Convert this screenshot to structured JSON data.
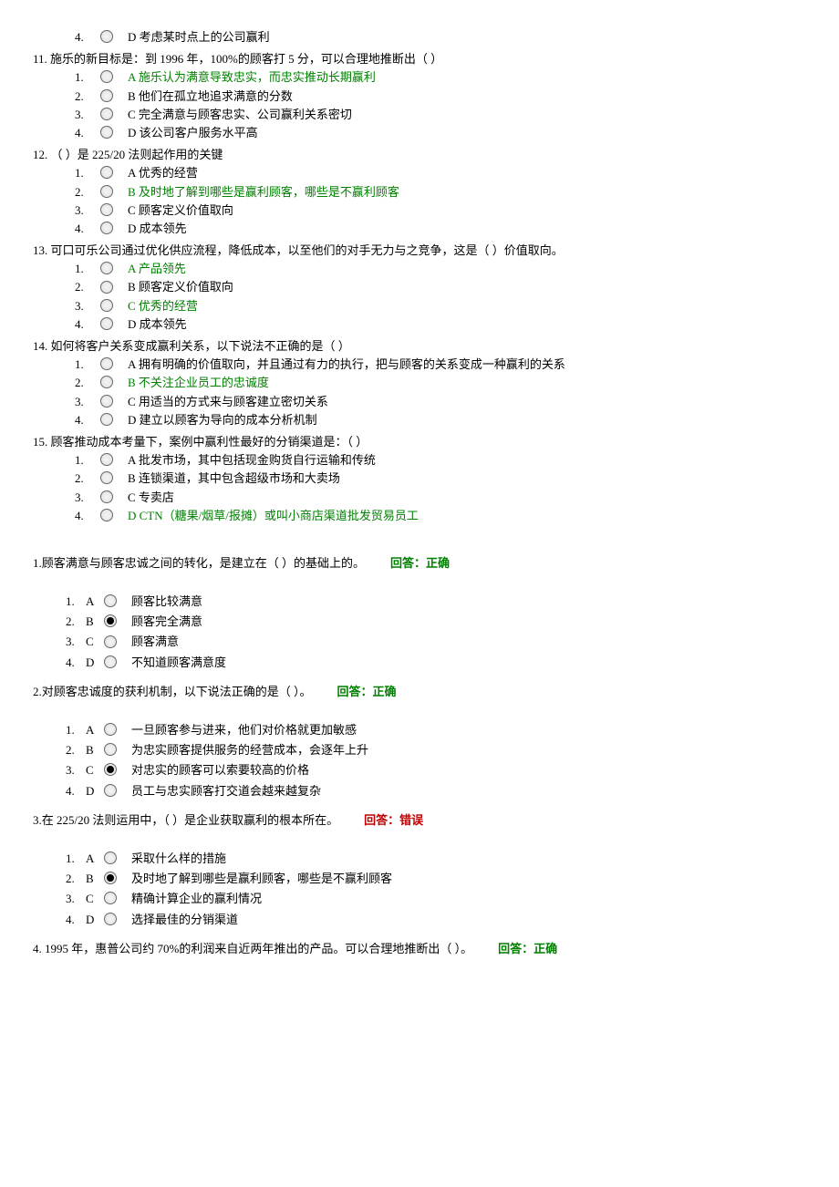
{
  "part1": [
    {
      "lead_option": {
        "num": "4.",
        "letter": "D",
        "text": "考虑某时点上的公司赢利",
        "green": false
      },
      "num": "11.",
      "stem": "施乐的新目标是：到 1996 年，100%的顾客打 5 分，可以合理地推断出（ ）",
      "opts": [
        {
          "num": "1.",
          "letter": "A",
          "text": "施乐认为满意导致忠实，而忠实推动长期赢利",
          "green": true
        },
        {
          "num": "2.",
          "letter": "B",
          "text": "他们在孤立地追求满意的分数",
          "green": false
        },
        {
          "num": "3.",
          "letter": "C",
          "text": "完全满意与顾客忠实、公司赢利关系密切",
          "green": false
        },
        {
          "num": "4.",
          "letter": "D",
          "text": "该公司客户服务水平高",
          "green": false
        }
      ]
    },
    {
      "num": "12.",
      "stem": "（ ）是 225/20 法则起作用的关键",
      "opts": [
        {
          "num": "1.",
          "letter": "A",
          "text": "优秀的经营",
          "green": false
        },
        {
          "num": "2.",
          "letter": "B",
          "text": "及时地了解到哪些是赢利顾客，哪些是不赢利顾客",
          "green": true
        },
        {
          "num": "3.",
          "letter": "C",
          "text": "顾客定义价值取向",
          "green": false
        },
        {
          "num": "4.",
          "letter": "D",
          "text": "成本领先",
          "green": false
        }
      ]
    },
    {
      "num": "13.",
      "stem": "可口可乐公司通过优化供应流程，降低成本，以至他们的对手无力与之竞争，这是（ ）价值取向。",
      "opts": [
        {
          "num": "1.",
          "letter": "A",
          "text": "产品领先",
          "green": true
        },
        {
          "num": "2.",
          "letter": "B",
          "text": "顾客定义价值取向",
          "green": false
        },
        {
          "num": "3.",
          "letter": "C",
          "text": "优秀的经营",
          "green": true
        },
        {
          "num": "4.",
          "letter": "D",
          "text": "成本领先",
          "green": false
        }
      ]
    },
    {
      "num": "14.",
      "stem": "如何将客户关系变成赢利关系，以下说法不正确的是（ ）",
      "opts": [
        {
          "num": "1.",
          "letter": "A",
          "text": "拥有明确的价值取向，并且通过有力的执行，把与顾客的关系变成一种赢利的关系",
          "green": false
        },
        {
          "num": "2.",
          "letter": "B",
          "text": "不关注企业员工的忠诚度",
          "green": true
        },
        {
          "num": "3.",
          "letter": "C",
          "text": "用适当的方式来与顾客建立密切关系",
          "green": false
        },
        {
          "num": "4.",
          "letter": "D",
          "text": "建立以顾客为导向的成本分析机制",
          "green": false
        }
      ]
    },
    {
      "num": "15.",
      "stem": "顾客推动成本考量下，案例中赢利性最好的分销渠道是：（ ）",
      "opts": [
        {
          "num": "1.",
          "letter": "A",
          "text": "批发市场，其中包括现金购货自行运输和传统",
          "green": false
        },
        {
          "num": "2.",
          "letter": "B",
          "text": "连锁渠道，其中包含超级市场和大卖场",
          "green": false
        },
        {
          "num": "3.",
          "letter": "C",
          "text": "专卖店",
          "green": false
        },
        {
          "num": "4.",
          "letter": "D",
          "text": "CTN（糖果/烟草/报摊）或叫小商店渠道批发贸易员工",
          "green": true
        }
      ]
    }
  ],
  "part2": [
    {
      "num": "1.",
      "stem": "顾客满意与顾客忠诚之间的转化，是建立在（ ）的基础上的。",
      "feedback": "回答：正确",
      "correct": true,
      "opts": [
        {
          "num": "1.",
          "letter": "A",
          "text": "顾客比较满意",
          "sel": false
        },
        {
          "num": "2.",
          "letter": "B",
          "text": "顾客完全满意",
          "sel": true
        },
        {
          "num": "3.",
          "letter": "C",
          "text": "顾客满意",
          "sel": false
        },
        {
          "num": "4.",
          "letter": "D",
          "text": "不知道顾客满意度",
          "sel": false
        }
      ]
    },
    {
      "num": "2.",
      "stem": "对顾客忠诚度的获利机制，以下说法正确的是（ ）。",
      "feedback": "回答：正确",
      "correct": true,
      "opts": [
        {
          "num": "1.",
          "letter": "A",
          "text": "一旦顾客参与进来，他们对价格就更加敏感",
          "sel": false
        },
        {
          "num": "2.",
          "letter": "B",
          "text": "为忠实顾客提供服务的经营成本，会逐年上升",
          "sel": false
        },
        {
          "num": "3.",
          "letter": "C",
          "text": "对忠实的顾客可以索要较高的价格",
          "sel": true
        },
        {
          "num": "4.",
          "letter": "D",
          "text": "员工与忠实顾客打交道会越来越复杂",
          "sel": false
        }
      ]
    },
    {
      "num": "3.",
      "stem": "在 225/20 法则运用中，（ ）是企业获取赢利的根本所在。",
      "feedback": "回答：错误",
      "correct": false,
      "opts": [
        {
          "num": "1.",
          "letter": "A",
          "text": "采取什么样的措施",
          "sel": false
        },
        {
          "num": "2.",
          "letter": "B",
          "text": "及时地了解到哪些是赢利顾客，哪些是不赢利顾客",
          "sel": true
        },
        {
          "num": "3.",
          "letter": "C",
          "text": "精确计算企业的赢利情况",
          "sel": false
        },
        {
          "num": "4.",
          "letter": "D",
          "text": "选择最佳的分销渠道",
          "sel": false
        }
      ]
    },
    {
      "num": "4.",
      "stem": " 1995 年，惠普公司约 70%的利润来自近两年推出的产品。可以合理地推断出（ ）。",
      "feedback": "回答：正确",
      "correct": true,
      "opts": []
    }
  ]
}
